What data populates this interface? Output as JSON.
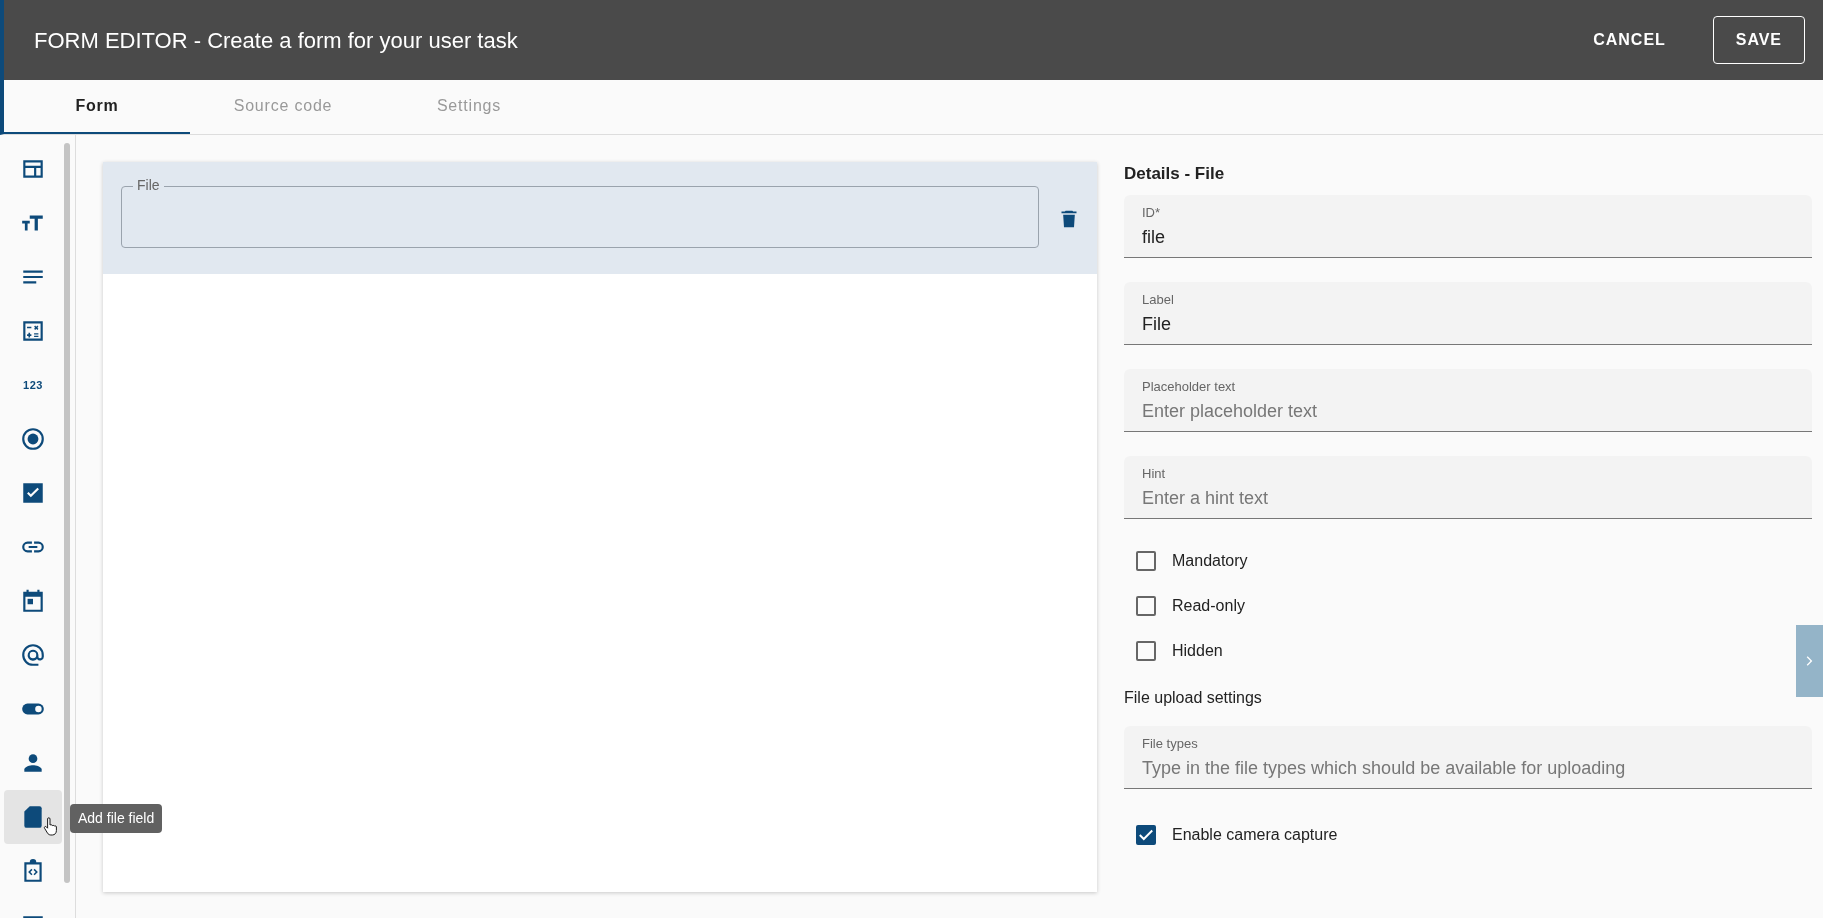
{
  "window": {
    "title": "FORM EDITOR - Create a form for your user task",
    "buttons": [
      {
        "label": "CANCEL",
        "kind": "text"
      },
      {
        "label": "SAVE",
        "kind": "outlined"
      }
    ]
  },
  "tabs": [
    {
      "label": "Form",
      "selected": true
    },
    {
      "label": "Source code",
      "selected": false
    },
    {
      "label": "Settings",
      "selected": false
    }
  ],
  "sidebar": {
    "items": [
      {
        "hovered": false
      },
      {
        "hovered": false
      },
      {
        "hovered": false
      },
      {
        "hovered": false
      },
      {
        "hovered": false,
        "text": "123"
      },
      {
        "hovered": false
      },
      {
        "hovered": false
      },
      {
        "hovered": false
      },
      {
        "hovered": false
      },
      {
        "hovered": false
      },
      {
        "hovered": false
      },
      {
        "hovered": false
      },
      {
        "hovered": true,
        "tooltip": "Add file field"
      },
      {
        "hovered": false
      },
      {
        "hovered": false
      }
    ]
  },
  "canvas": {
    "fields": [
      {
        "label": "File",
        "selected": true
      }
    ]
  },
  "details": {
    "title": "Details - File",
    "fields": [
      {
        "label": "ID*",
        "value": "file"
      },
      {
        "label": "Label",
        "value": "File"
      },
      {
        "label": "Placeholder text",
        "placeholder": "Enter placeholder text"
      },
      {
        "label": "Hint",
        "placeholder": "Enter a hint text"
      }
    ],
    "options": [
      {
        "label": "Mandatory",
        "checked": false
      },
      {
        "label": "Read-only",
        "checked": false
      },
      {
        "label": "Hidden",
        "checked": false
      }
    ],
    "upload_title": "File upload settings",
    "upload_fields": [
      {
        "label": "File types",
        "placeholder": "Type in the file types which should be available for uploading"
      }
    ],
    "upload_options": [
      {
        "label": "Enable camera capture",
        "checked": true
      }
    ]
  }
}
